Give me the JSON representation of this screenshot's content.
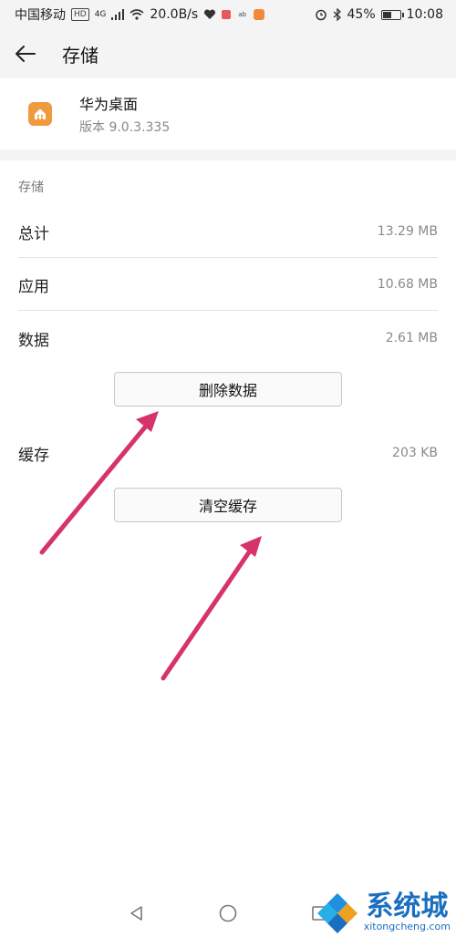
{
  "status_bar": {
    "carrier": "中国移动",
    "hd_badge": "HD",
    "network_badge": "4G",
    "speed": "20.0B/s",
    "battery": "45%",
    "battery_level": 0.45,
    "time": "10:08",
    "icons": [
      "signal-icon",
      "wifi-icon",
      "heart-icon",
      "notification-icon",
      "alarm-icon",
      "bluetooth-icon",
      "battery-icon"
    ]
  },
  "header": {
    "title": "存储",
    "back_icon": "back-arrow-icon"
  },
  "app": {
    "name": "华为桌面",
    "version": "版本 9.0.3.335",
    "icon": "home-icon",
    "icon_color": "#f09a40"
  },
  "storage": {
    "section_title": "存储",
    "rows": [
      {
        "label": "总计",
        "value": "13.29 MB"
      },
      {
        "label": "应用",
        "value": "10.68 MB"
      },
      {
        "label": "数据",
        "value": "2.61 MB"
      }
    ],
    "delete_data_button": "删除数据",
    "cache_label": "缓存",
    "cache_value": "203 KB",
    "clear_cache_button": "清空缓存"
  },
  "annotation": {
    "arrow_color": "#d6336c"
  },
  "nav_bar": {
    "back": "nav-back-icon",
    "home": "nav-home-icon",
    "recents": "nav-recents-icon"
  },
  "watermark": {
    "cn": "系统城",
    "en": "xitongcheng.com"
  }
}
